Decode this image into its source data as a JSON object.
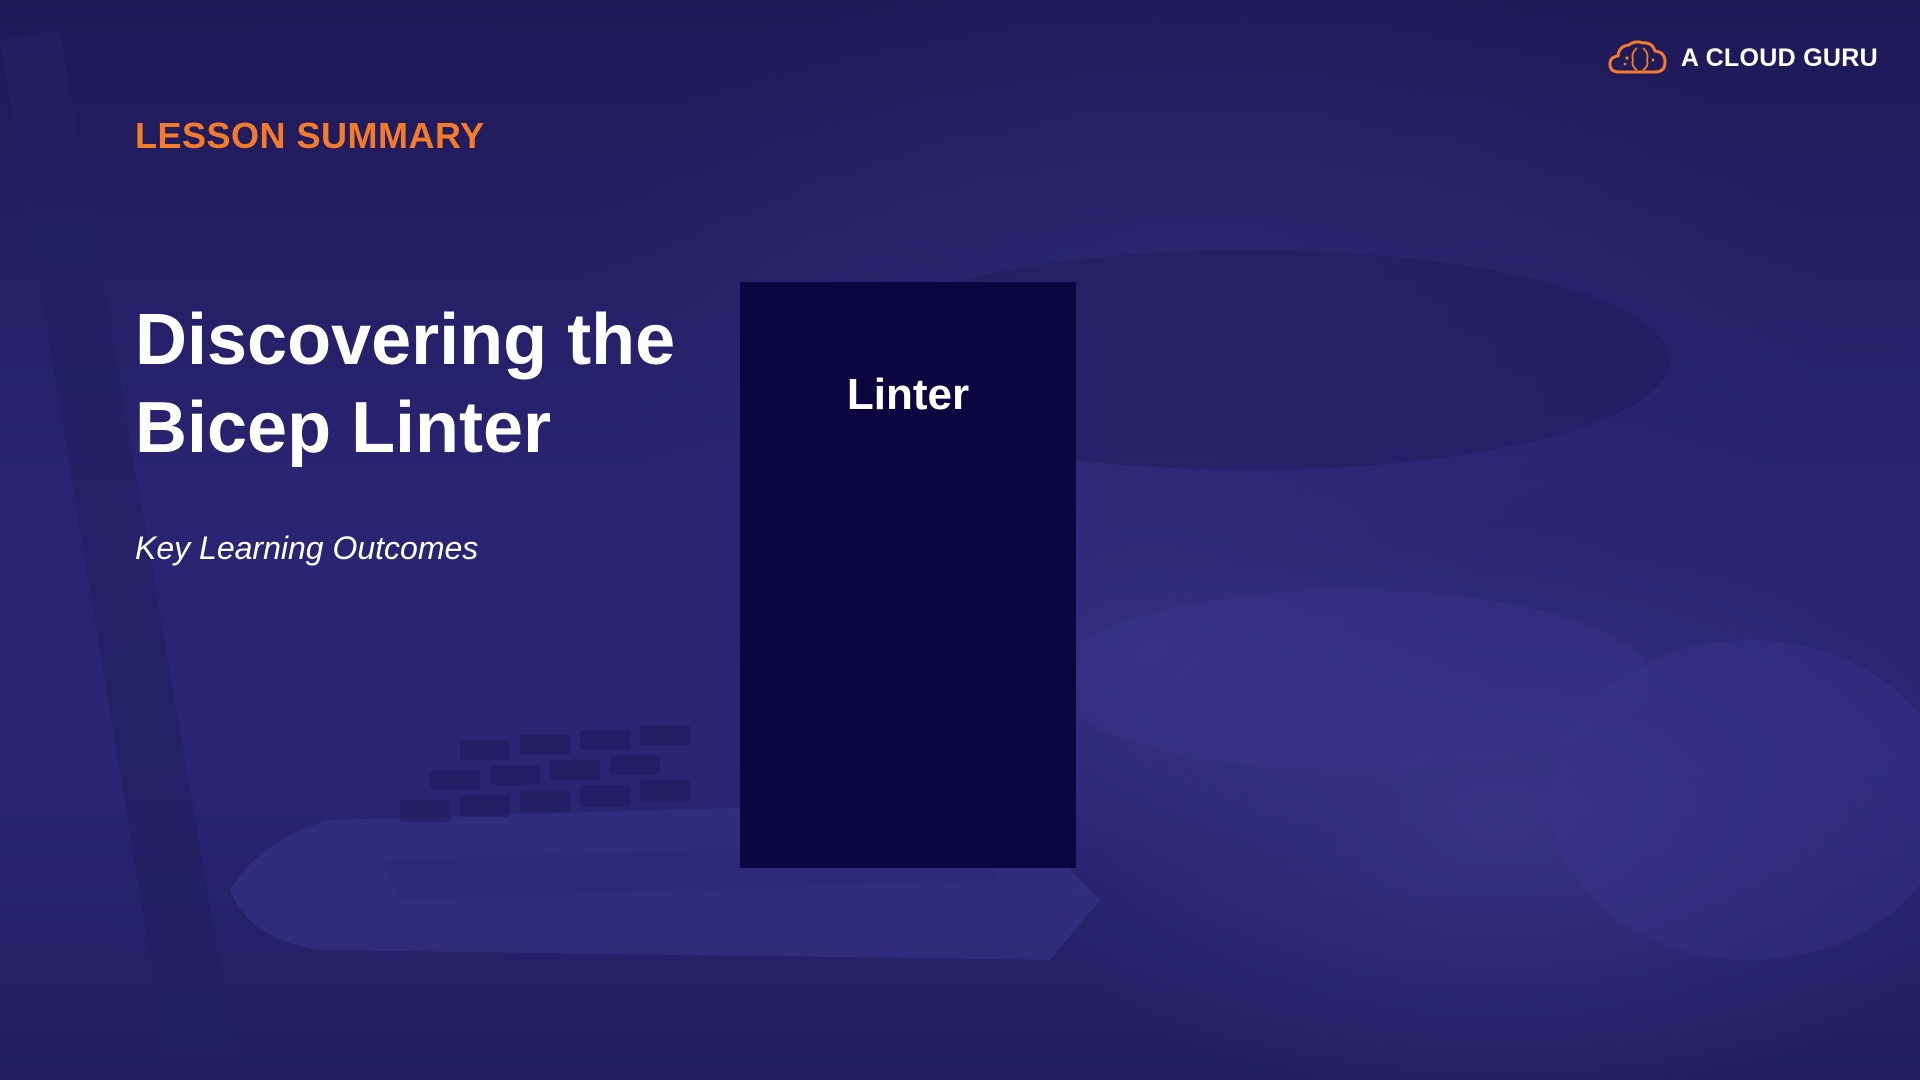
{
  "brand": {
    "name": "A CLOUD GURU",
    "logo_icon": "cloud-brain-icon",
    "accent_color": "#f47b2a"
  },
  "slide": {
    "kicker": "LESSON SUMMARY",
    "title_line1": "Discovering the",
    "title_line2": "Bicep Linter",
    "subtitle": "Key Learning Outcomes",
    "background_color": "#26216a"
  },
  "card": {
    "title": "Linter",
    "background_color": "#0c0640"
  }
}
